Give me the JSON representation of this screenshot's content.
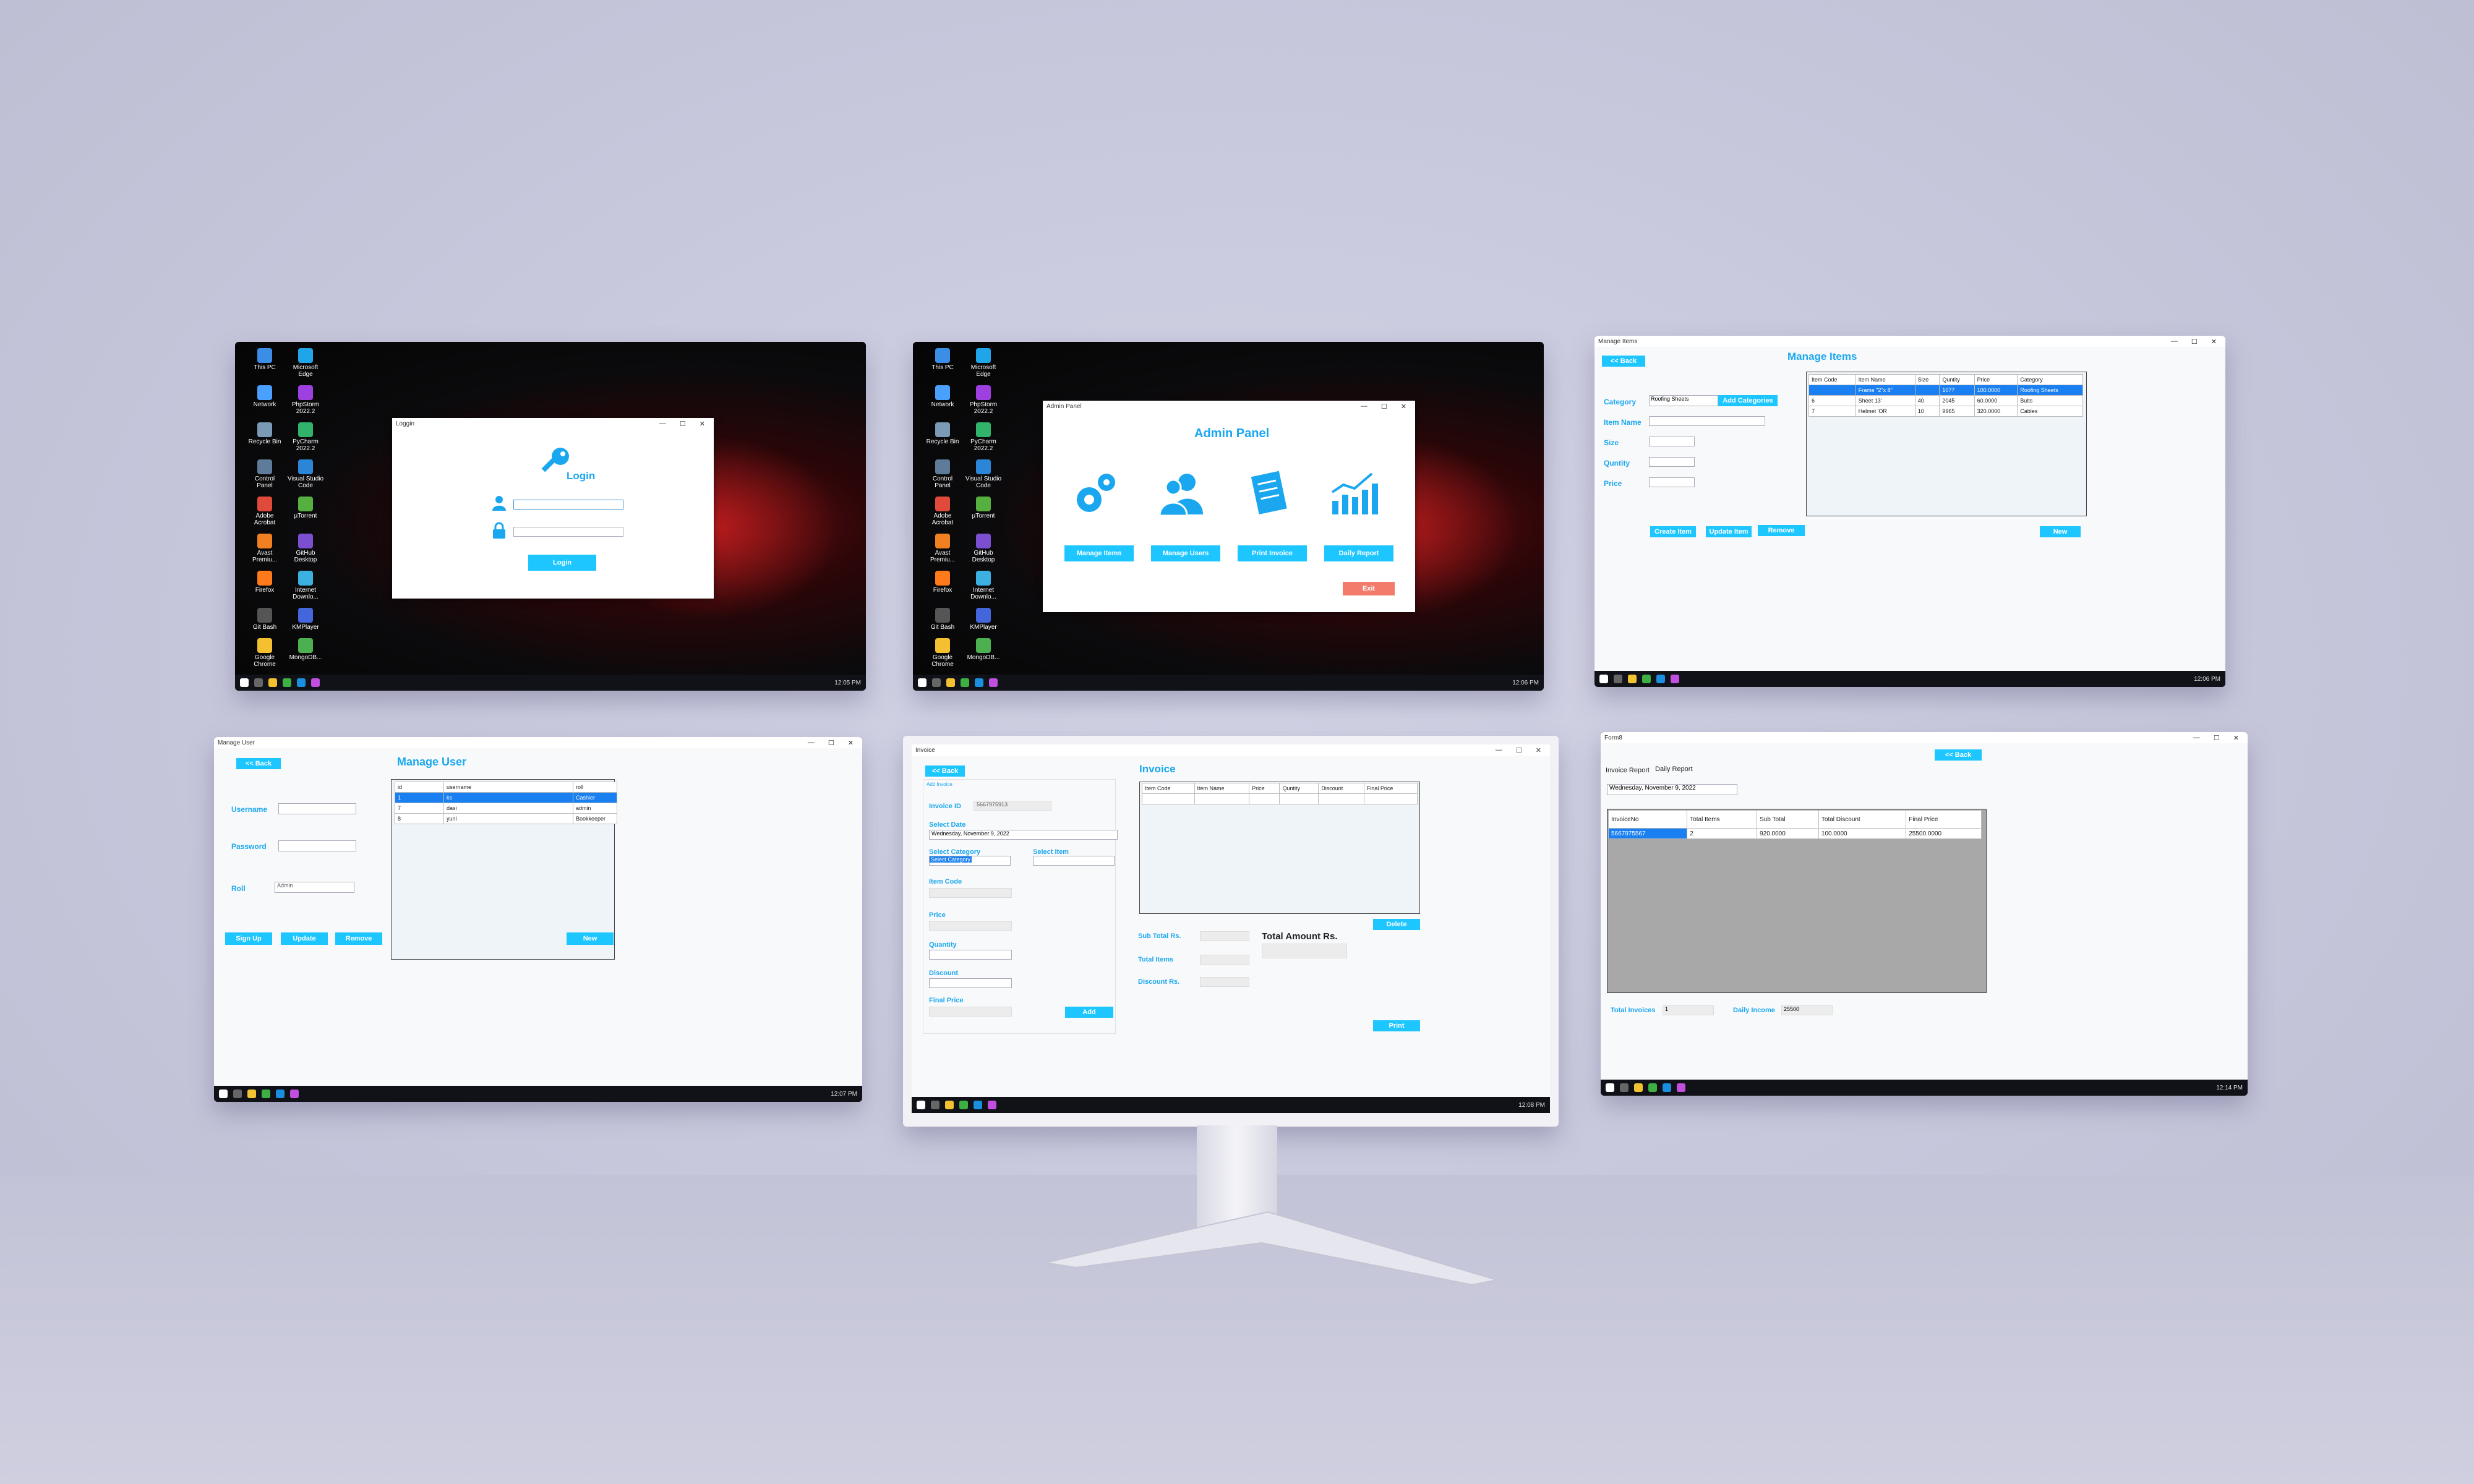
{
  "colors": {
    "accent": "#1ec6ff",
    "title_blue": "#1aa7f0",
    "exit_button": "#f27b6b",
    "selection": "#1a7ff0",
    "taskbar": "#101218"
  },
  "desktop_icons": [
    {
      "label": "This PC",
      "icon": "computer-icon"
    },
    {
      "label": "Microsoft Edge",
      "icon": "edge-icon"
    },
    {
      "label": "Network",
      "icon": "network-icon"
    },
    {
      "label": "PhpStorm 2022.2",
      "icon": "phpstorm-icon"
    },
    {
      "label": "Recycle Bin",
      "icon": "recycle-bin-icon"
    },
    {
      "label": "PyCharm 2022.2",
      "icon": "pycharm-icon"
    },
    {
      "label": "Control Panel",
      "icon": "control-panel-icon"
    },
    {
      "label": "Visual Studio Code",
      "icon": "vscode-icon"
    },
    {
      "label": "Adobe Acrobat",
      "icon": "acrobat-icon"
    },
    {
      "label": "µTorrent",
      "icon": "utorrent-icon"
    },
    {
      "label": "Avast Premiu...",
      "icon": "avast-icon"
    },
    {
      "label": "GitHub Desktop",
      "icon": "github-icon"
    },
    {
      "label": "Firefox",
      "icon": "firefox-icon"
    },
    {
      "label": "Internet Downlo...",
      "icon": "idm-icon"
    },
    {
      "label": "Git Bash",
      "icon": "git-bash-icon"
    },
    {
      "label": "KMPlayer",
      "icon": "kmplayer-icon"
    },
    {
      "label": "Google Chrome",
      "icon": "chrome-icon"
    },
    {
      "label": "MongoDB...",
      "icon": "mongodb-icon"
    }
  ],
  "taskbar": {
    "time_1": "12:05 PM",
    "time_2": "12:06 PM",
    "time_3": "12:06 PM",
    "time_4": "12:07 PM",
    "time_5": "12:08 PM",
    "time_6": "12:14 PM"
  },
  "login": {
    "window_title": "Loggin",
    "heading": "Login",
    "button": "Login"
  },
  "admin": {
    "window_title": "Admin Panel",
    "heading": "Admin Panel",
    "buttons": [
      "Manage Items",
      "Manage Users",
      "Print Invoice",
      "Daily Report"
    ],
    "icons": [
      "gears-icon",
      "users-icon",
      "invoice-icon",
      "chart-icon"
    ],
    "exit": "Exit"
  },
  "manage_items": {
    "window_title": "Manage Items",
    "heading": "Manage Items",
    "back": "<< Back",
    "labels": [
      "Category",
      "Item Name",
      "Size",
      "Quntity",
      "Price"
    ],
    "category_value": "Roofing Sheets",
    "add_categories": "Add Categories",
    "columns": [
      "Item Code",
      "Item Name",
      "Size",
      "Quntity",
      "Price",
      "Category"
    ],
    "rows": [
      [
        "",
        "Frame \"2\"x 8\"",
        "",
        "1077",
        "100.0000",
        "Roofing Sheets"
      ],
      [
        "6",
        "Sheet 13'",
        "40",
        "2045",
        "60.0000",
        "Bults"
      ],
      [
        "7",
        "Helmet 'OR",
        "10",
        "9965",
        "320.0000",
        "Cables"
      ]
    ],
    "buttons": [
      "Create Item",
      "Update Item",
      "Remove",
      "New"
    ]
  },
  "manage_user": {
    "window_title": "Manage User",
    "heading": "Manage User",
    "back": "<< Back",
    "labels": [
      "Username",
      "Password",
      "Roll"
    ],
    "roll_value": "Admin",
    "columns": [
      "id",
      "username",
      "roll"
    ],
    "rows": [
      [
        "1",
        "ks",
        "Cashier"
      ],
      [
        "7",
        "dasi",
        "admin"
      ],
      [
        "8",
        "yuni",
        "Bookkeeper"
      ]
    ],
    "buttons": [
      "Sign Up",
      "Update",
      "Remove",
      "New"
    ]
  },
  "invoice": {
    "window_title": "Invoice",
    "heading": "Invoice",
    "back": "<< Back",
    "group_title": "Add Invoice",
    "invoice_id_label": "Invoice ID",
    "invoice_id_value": "5667975913",
    "select_date_label": "Select Date",
    "date_value": "Wednesday, November 9, 2022",
    "select_category_label": "Select Category",
    "select_category_value": "Select Category",
    "select_item_label": "Select Item",
    "fields": [
      "Item Code",
      "Price",
      "Quantity",
      "Discount",
      "Final Price"
    ],
    "add": "Add",
    "columns": [
      "Item Code",
      "Item Name",
      "Price",
      "Quntity",
      "Discount",
      "Final Price"
    ],
    "delete": "Delete",
    "summary": [
      "Sub Total Rs.",
      "Total Items",
      "Discount Rs."
    ],
    "total_amount": "Total Amount Rs.",
    "print": "Print"
  },
  "report": {
    "window_title": "Form8",
    "back": "<< Back",
    "tabs": [
      "Invoice Report",
      "Daily Report"
    ],
    "date_value": "Wednesday, November 9, 2022",
    "columns": [
      "InvoiceNo",
      "Total Items",
      "Sub Total",
      "Total Discount",
      "Final Price"
    ],
    "row": [
      "5667975567",
      "2",
      "920.0000",
      "100.0000",
      "25500.0000"
    ],
    "total_invoices_label": "Total Invoices",
    "total_invoices_value": "1",
    "daily_income_label": "Daily Income",
    "daily_income_value": "25500"
  }
}
